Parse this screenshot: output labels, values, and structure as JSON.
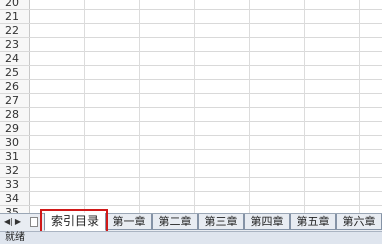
{
  "sheet": {
    "row_numbers": [
      "20",
      "21",
      "22",
      "23",
      "24",
      "25",
      "26",
      "27",
      "28",
      "29",
      "30",
      "31",
      "32",
      "33",
      "34",
      "35"
    ]
  },
  "tabs": {
    "nav_first_icon": "first-sheet-arrow-icon",
    "nav_prev_icon": "prev-sheet-arrow-icon",
    "items": [
      {
        "label": "索引目录",
        "active": true
      },
      {
        "label": "第一章",
        "active": false
      },
      {
        "label": "第二章",
        "active": false
      },
      {
        "label": "第三章",
        "active": false
      },
      {
        "label": "第四章",
        "active": false
      },
      {
        "label": "第五章",
        "active": false
      },
      {
        "label": "第六章",
        "active": false
      }
    ]
  },
  "status": {
    "text": "就绪"
  },
  "colors": {
    "highlight": "#d01818",
    "tab_bar": "#e8ecf2",
    "status_bar": "#dfe5ee"
  }
}
